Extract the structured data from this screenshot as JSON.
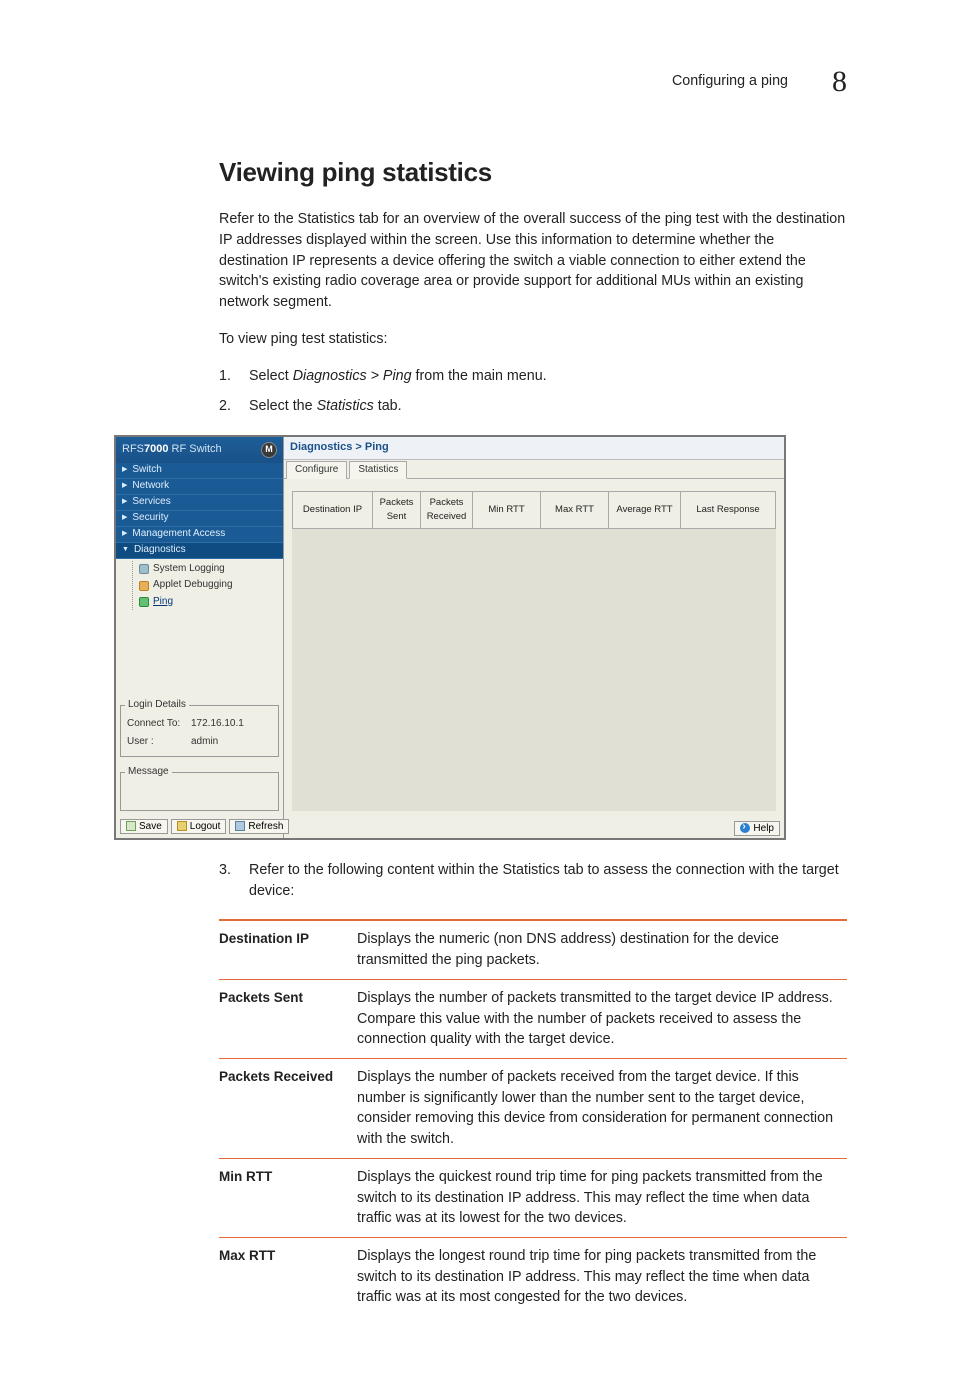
{
  "header": {
    "section": "Configuring a ping",
    "chapter": "8"
  },
  "title": "Viewing ping statistics",
  "intro": "Refer to the Statistics tab for an overview of the overall success of the ping test with the destination IP addresses displayed within the screen. Use this information to determine whether the destination IP represents a device offering the switch a viable connection to either extend the switch's existing radio coverage area or provide support for additional MUs within an existing network segment.",
  "lead": "To view ping test statistics:",
  "steps": {
    "s1_pre": "Select ",
    "s1_mid": "Diagnostics > Ping",
    "s1_post": " from the main menu.",
    "s2_pre": "Select the ",
    "s2_mid": "Statistics",
    "s2_post": " tab.",
    "s3": "Refer to the following content within the Statistics tab to assess the connection with the target device:"
  },
  "app": {
    "brand_prefix": "RFS",
    "brand_model": "7000",
    "brand_suffix": " RF Switch",
    "nav": {
      "switch": "Switch",
      "network": "Network",
      "services": "Services",
      "security": "Security",
      "management": "Management Access",
      "diagnostics": "Diagnostics"
    },
    "subnav": {
      "syslog": "System Logging",
      "applet": "Applet Debugging",
      "ping": "Ping"
    },
    "login": {
      "title": "Login Details",
      "connect_k": "Connect To:",
      "connect_v": "172.16.10.1",
      "user_k": "User :",
      "user_v": "admin"
    },
    "message_title": "Message",
    "buttons": {
      "save": "Save",
      "logout": "Logout",
      "refresh": "Refresh",
      "help": "Help"
    },
    "breadcrumb": "Diagnostics > Ping",
    "tabs": {
      "configure": "Configure",
      "statistics": "Statistics"
    },
    "columns": {
      "dest": "Destination IP",
      "sent": "Packets Sent",
      "recv": "Packets Received",
      "min": "Min RTT",
      "max": "Max RTT",
      "avg": "Average RTT",
      "last": "Last Response"
    }
  },
  "defs": [
    {
      "k": "Destination IP",
      "v": "Displays the numeric (non DNS address) destination for the device transmitted the ping packets."
    },
    {
      "k": "Packets Sent",
      "v": "Displays the number of packets transmitted to the target device IP address. Compare this value with the number of packets received to assess the connection quality with the target device."
    },
    {
      "k": "Packets Received",
      "v": "Displays the number of packets received from the target device. If this number is significantly lower than the number sent to the target device, consider removing this device from consideration for permanent connection with the switch."
    },
    {
      "k": "Min RTT",
      "v": "Displays the quickest round trip time for ping packets transmitted from the switch to its destination IP address. This may reflect the time when data traffic was at its lowest for the two devices."
    },
    {
      "k": "Max RTT",
      "v": "Displays the longest round trip time for ping packets transmitted from the switch to its destination IP address. This may reflect the time when data traffic was at its most congested for the two devices."
    }
  ]
}
